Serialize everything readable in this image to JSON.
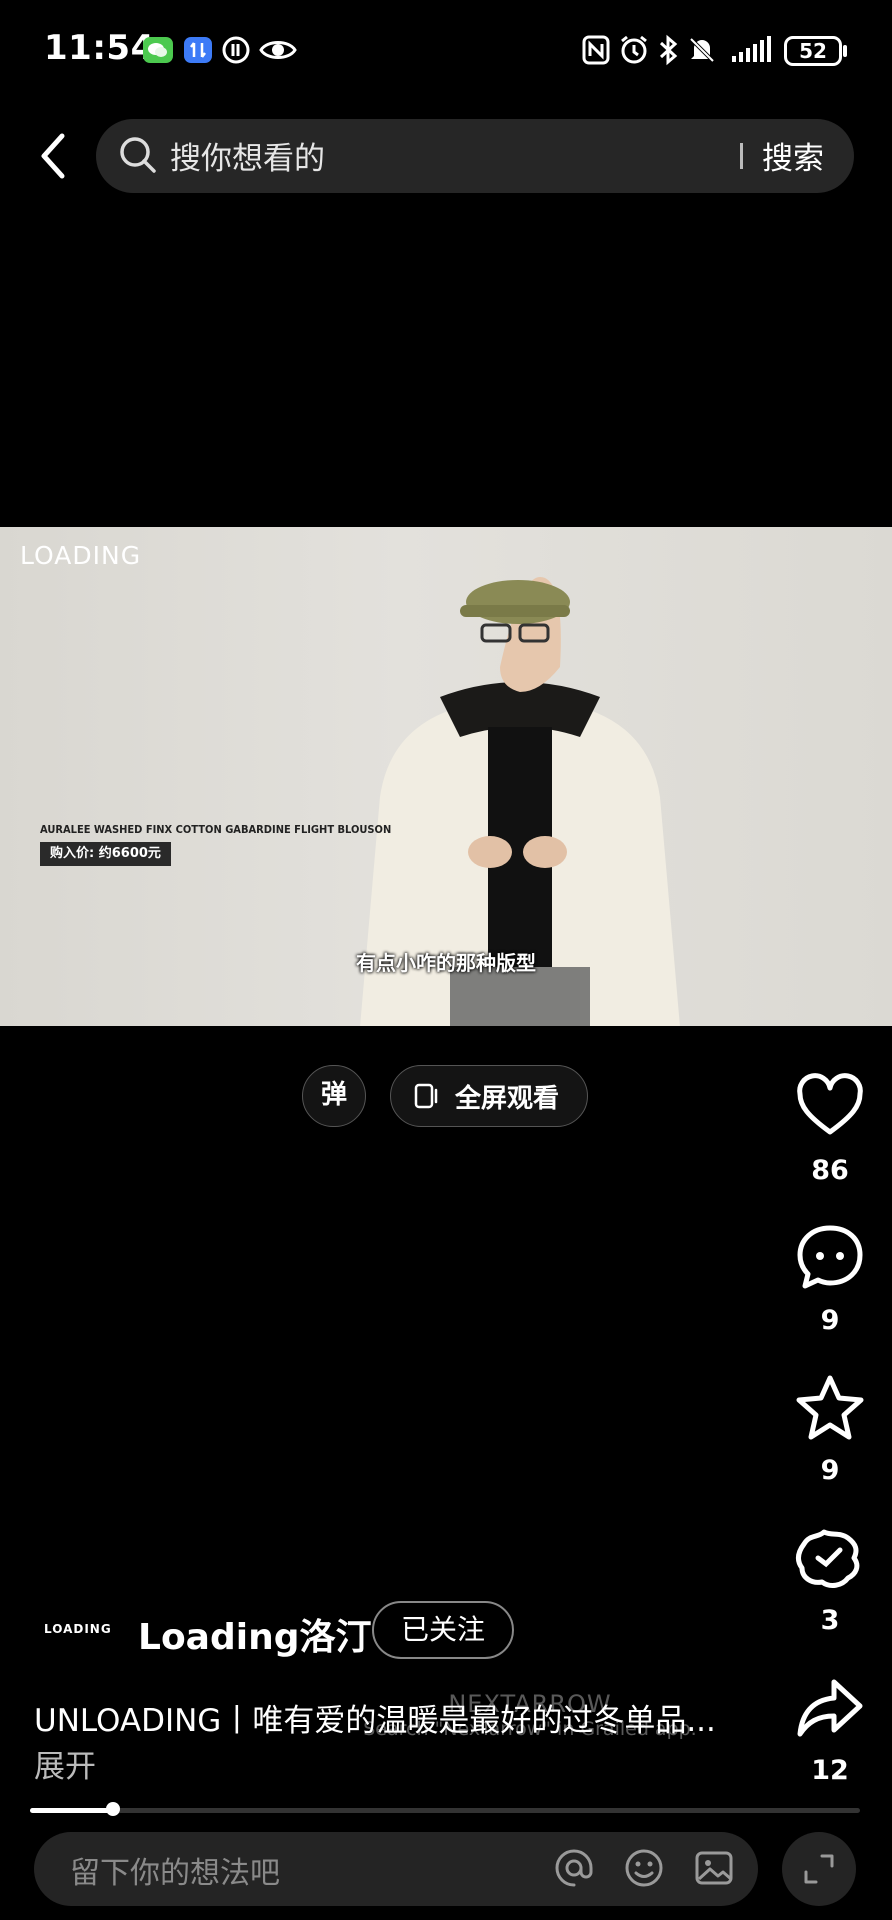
{
  "status_bar": {
    "time": "11:54",
    "battery": "52"
  },
  "search": {
    "placeholder": "搜你想看的",
    "button": "搜索"
  },
  "video": {
    "brand": "LOADING",
    "product_name": "AURALEE WASHED FINX COTTON GABARDINE FLIGHT BLOUSON",
    "product_price": "购入价: 约6600元",
    "subtitle": "有点小咋的那种版型"
  },
  "controls": {
    "danmu": "弹",
    "fullscreen": "全屏观看"
  },
  "actions": {
    "likes": "86",
    "comments": "9",
    "favorites": "9",
    "gifts": "3",
    "shares": "12"
  },
  "author": {
    "logo_text": "LOADING",
    "name": "Loading洛汀",
    "follow_label": "已关注"
  },
  "post": {
    "description": "UNLOADING丨唯有爱的温暖是最好的过冬单品...",
    "expand": "展开"
  },
  "watermark": {
    "title": "NEXTARROW",
    "subtitle": "Search \"NexTarrow\" in Grailed app."
  },
  "playback": {
    "progress": 0.1
  },
  "comment": {
    "placeholder": "留下你的想法吧"
  }
}
